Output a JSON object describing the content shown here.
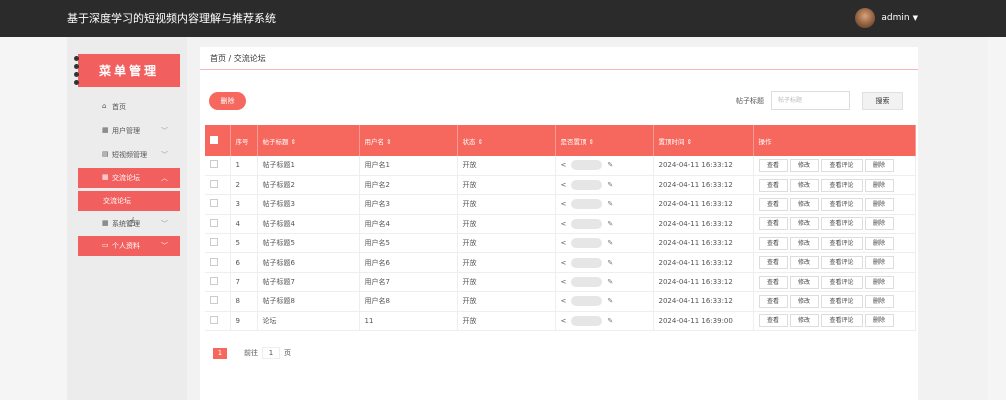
{
  "app": {
    "title": "基于深度学习的短视频内容理解与推荐系统"
  },
  "user": {
    "name": "admin"
  },
  "sidebar": {
    "header": "菜单管理",
    "items": [
      {
        "label": "首页"
      },
      {
        "label": "用户管理"
      },
      {
        "label": "短视频管理"
      },
      {
        "label": "交流论坛"
      },
      {
        "label": "交流论坛"
      },
      {
        "label": "系统管理"
      },
      {
        "label": "个人资料"
      }
    ]
  },
  "breadcrumb": {
    "home": "首页",
    "sep": " / ",
    "current": "交流论坛"
  },
  "toolbar": {
    "delete": "删除",
    "search_label": "帖子标题",
    "search_placeholder": "帖子标题",
    "search_button": "搜索"
  },
  "table": {
    "headers": [
      "序号",
      "帖子标题 ⇕",
      "用户名 ⇕",
      "状态 ⇕",
      "是否置顶 ⇕",
      "置顶时间 ⇕",
      "操作"
    ],
    "rows": [
      {
        "idx": "1",
        "title": "帖子标题1",
        "user": "用户名1",
        "status": "开放",
        "time": "2024-04-11 16:33:12"
      },
      {
        "idx": "2",
        "title": "帖子标题2",
        "user": "用户名2",
        "status": "开放",
        "time": "2024-04-11 16:33:12"
      },
      {
        "idx": "3",
        "title": "帖子标题3",
        "user": "用户名3",
        "status": "开放",
        "time": "2024-04-11 16:33:12"
      },
      {
        "idx": "4",
        "title": "帖子标题4",
        "user": "用户名4",
        "status": "开放",
        "time": "2024-04-11 16:33:12"
      },
      {
        "idx": "5",
        "title": "帖子标题5",
        "user": "用户名5",
        "status": "开放",
        "time": "2024-04-11 16:33:12"
      },
      {
        "idx": "6",
        "title": "帖子标题6",
        "user": "用户名6",
        "status": "开放",
        "time": "2024-04-11 16:33:12"
      },
      {
        "idx": "7",
        "title": "帖子标题7",
        "user": "用户名7",
        "status": "开放",
        "time": "2024-04-11 16:33:12"
      },
      {
        "idx": "8",
        "title": "帖子标题8",
        "user": "用户名8",
        "status": "开放",
        "time": "2024-04-11 16:33:12"
      },
      {
        "idx": "9",
        "title": "论坛",
        "user": "11",
        "status": "开放",
        "time": "2024-04-11 16:39:00"
      }
    ],
    "actions": [
      "查看",
      "修改",
      "查看评论",
      "删除"
    ]
  },
  "pager": {
    "current": "1",
    "goto_prefix": "前往",
    "goto_value": "1",
    "goto_suffix": "页"
  },
  "colors": {
    "accent": "#f6685e",
    "topbar": "#2b2b2b"
  }
}
